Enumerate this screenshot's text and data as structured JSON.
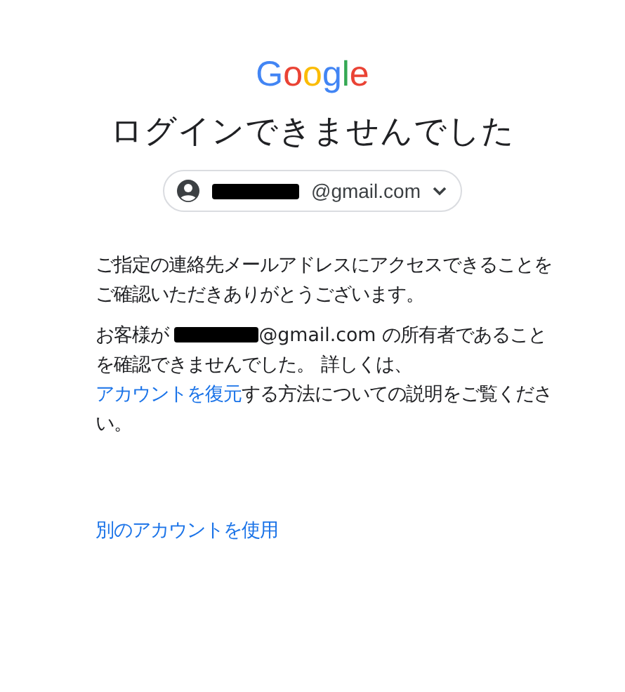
{
  "logo": "Google",
  "title": "ログインできませんでした",
  "account": {
    "email": "@gmail.com",
    "redacted": true
  },
  "paragraphs": [
    {
      "parts": [
        {
          "kind": "text",
          "text": "ご指定の連絡先メールアドレスにアクセスできることをご確認いただきありがとうございます。"
        }
      ]
    },
    {
      "parts": [
        {
          "kind": "text",
          "text": "お客様が "
        },
        {
          "kind": "redaction"
        },
        {
          "kind": "text",
          "text": "@gmail.com の所有者であることを確認できませんでした。 詳しくは、"
        },
        {
          "kind": "link",
          "text": "アカウントを復元"
        },
        {
          "kind": "text",
          "text": "する方法についての説明をご覧ください。"
        }
      ]
    }
  ],
  "other_account_link": "別のアカウントを使用"
}
